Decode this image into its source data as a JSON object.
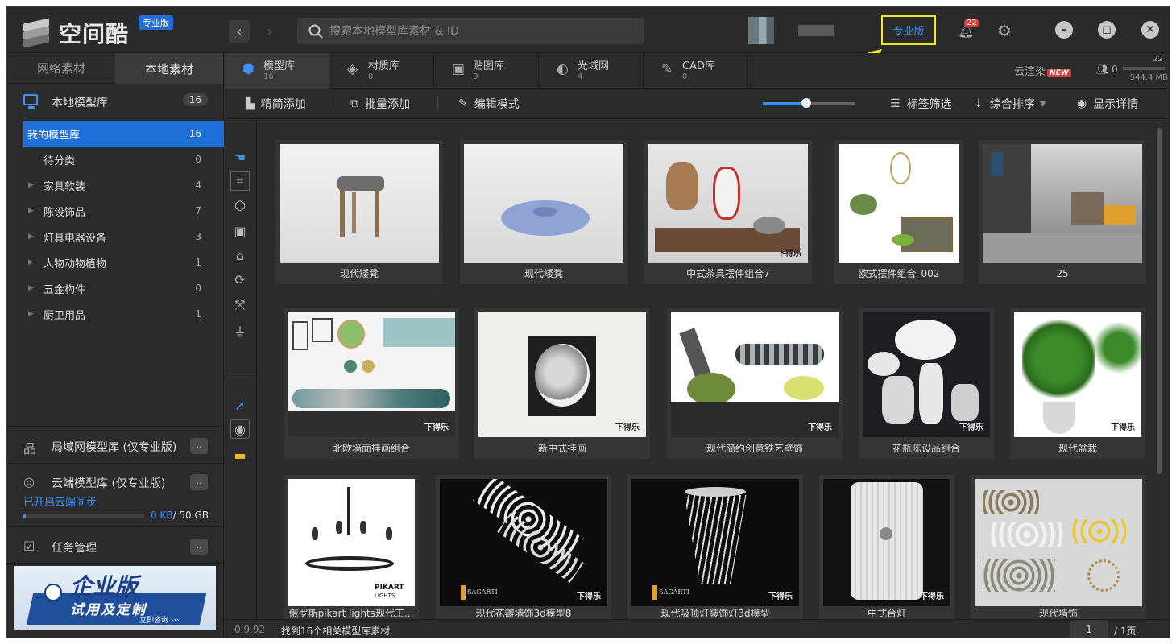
{
  "app": {
    "logo_text": "空间酷",
    "edition_badge": "专业版",
    "pro_button": "专业版",
    "notification_count": "22",
    "accent_color": "#1f6fd8",
    "highlight_color": "#f2e620"
  },
  "search": {
    "placeholder": "搜索本地模型库素材 & ID"
  },
  "sidebar": {
    "tabs": [
      {
        "label": "网络素材"
      },
      {
        "label": "本地素材"
      }
    ],
    "library": {
      "label": "本地模型库",
      "count": "16"
    },
    "tree": [
      {
        "label": "我的模型库",
        "count": "16"
      },
      {
        "label": "待分类",
        "count": "0"
      },
      {
        "label": "家具软装",
        "count": "4"
      },
      {
        "label": "陈设饰品",
        "count": "7"
      },
      {
        "label": "灯具电器设备",
        "count": "3"
      },
      {
        "label": "人物动物植物",
        "count": "1"
      },
      {
        "label": "五金构件",
        "count": "0"
      },
      {
        "label": "厨卫用品",
        "count": "1"
      }
    ],
    "lan_library": "局域网模型库 (仅专业版)",
    "cloud_library": "云端模型库 (仅专业版)",
    "sync_status": "已开启云端同步",
    "storage_used": "0 KB",
    "storage_total": "/ 50 GB",
    "storage_fraction": 0.0,
    "task_manager": "任务管理",
    "more_label": "..",
    "promo": {
      "title": "企业版",
      "subtitle": "试用及定制",
      "link": "立即咨询 ›››"
    }
  },
  "resource_tabs": [
    {
      "label": "模型库",
      "count": "16",
      "icon": "cube-icon"
    },
    {
      "label": "材质库",
      "count": "0",
      "icon": "material-icon"
    },
    {
      "label": "贴图库",
      "count": "0",
      "icon": "image-icon"
    },
    {
      "label": "光域网",
      "count": "4",
      "icon": "light-icon"
    },
    {
      "label": "CAD库",
      "count": "0",
      "icon": "cad-icon"
    }
  ],
  "top_right": {
    "cloud_render": "云渲染",
    "new_badge": "NEW",
    "user_count": "0",
    "usage_count": "22",
    "usage_size": "544.4 MB"
  },
  "toolbar": {
    "simple_add": "精简添加",
    "batch_add": "批量添加",
    "edit_mode": "编辑模式",
    "tag_filter": "标签筛选",
    "sort": "综合排序",
    "show_details": "显示详情",
    "zoom_level": 0.47
  },
  "models": [
    {
      "name": "现代矮凳"
    },
    {
      "name": "现代矮凳"
    },
    {
      "name": "中式茶具摆件组合7"
    },
    {
      "name": "欧式摆件组合_002"
    },
    {
      "name": "25"
    },
    {
      "name": "北欧墙面挂画组合"
    },
    {
      "name": "新中式挂画"
    },
    {
      "name": "现代简约创意铁艺壁饰"
    },
    {
      "name": "花瓶陈设品组合"
    },
    {
      "name": "现代盆栽"
    },
    {
      "name": "俄罗斯pikart lights现代工..."
    },
    {
      "name": "现代花瓣墙饰3d模型8"
    },
    {
      "name": "现代吸顶灯装饰灯3d模型"
    },
    {
      "name": "中式台灯"
    },
    {
      "name": "现代墙饰"
    }
  ],
  "watermark": "下得乐",
  "pikart_label": "PIKART",
  "pikart_sub": "LIGHTS",
  "sagarti_label": "SAGARTI",
  "status": {
    "version": "0.9.92",
    "found_text": "找到16个相关模型库素材.",
    "page": "1",
    "total_pages": "/ 1页"
  }
}
